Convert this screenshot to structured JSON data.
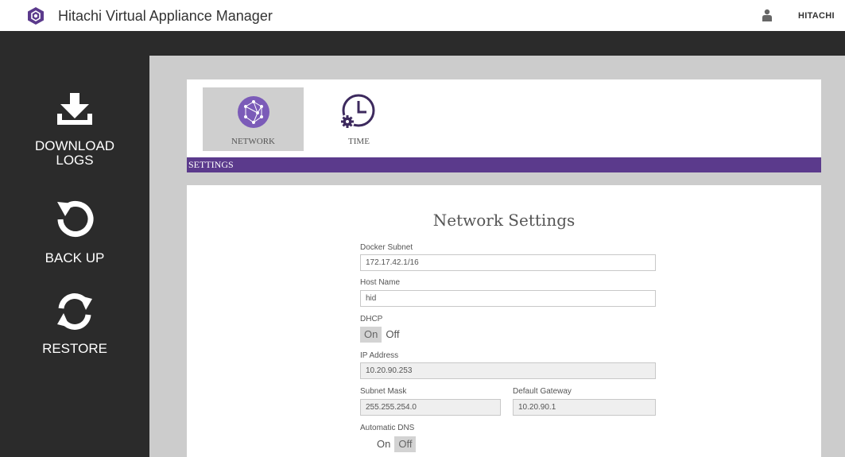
{
  "header": {
    "app_title": "Hitachi Virtual Appliance Manager",
    "brand": "HITACHI",
    "logo_icon": "hexagon-logo-icon",
    "user_icon": "user-icon",
    "accent": "#5b3a8c"
  },
  "sidebar": {
    "items": [
      {
        "icon": "download-icon",
        "label_line1": "Download",
        "label_line2": "Logs"
      },
      {
        "icon": "backup-icon",
        "label_line1": "Back Up"
      },
      {
        "icon": "restore-icon",
        "label_line1": "Restore"
      }
    ]
  },
  "tabs": [
    {
      "label": "NETWORK",
      "icon": "network-icon",
      "active": true
    },
    {
      "label": "TIME",
      "icon": "clock-gear-icon",
      "active": false
    }
  ],
  "section_bar": "SETTINGS",
  "form": {
    "title": "Network Settings",
    "docker_subnet": {
      "label": "Docker Subnet",
      "value": "172.17.42.1/16"
    },
    "host_name": {
      "label": "Host Name",
      "value": "hid"
    },
    "dhcp": {
      "label": "DHCP",
      "on": "On",
      "off": "Off",
      "selected": "On"
    },
    "ip_address": {
      "label": "IP Address",
      "value": "10.20.90.253"
    },
    "subnet_mask": {
      "label": "Subnet Mask",
      "value": "255.255.254.0"
    },
    "default_gateway": {
      "label": "Default Gateway",
      "value": "10.20.90.1"
    },
    "automatic_dns": {
      "label": "Automatic DNS",
      "on": "On",
      "off": "Off",
      "selected": "Off"
    }
  }
}
